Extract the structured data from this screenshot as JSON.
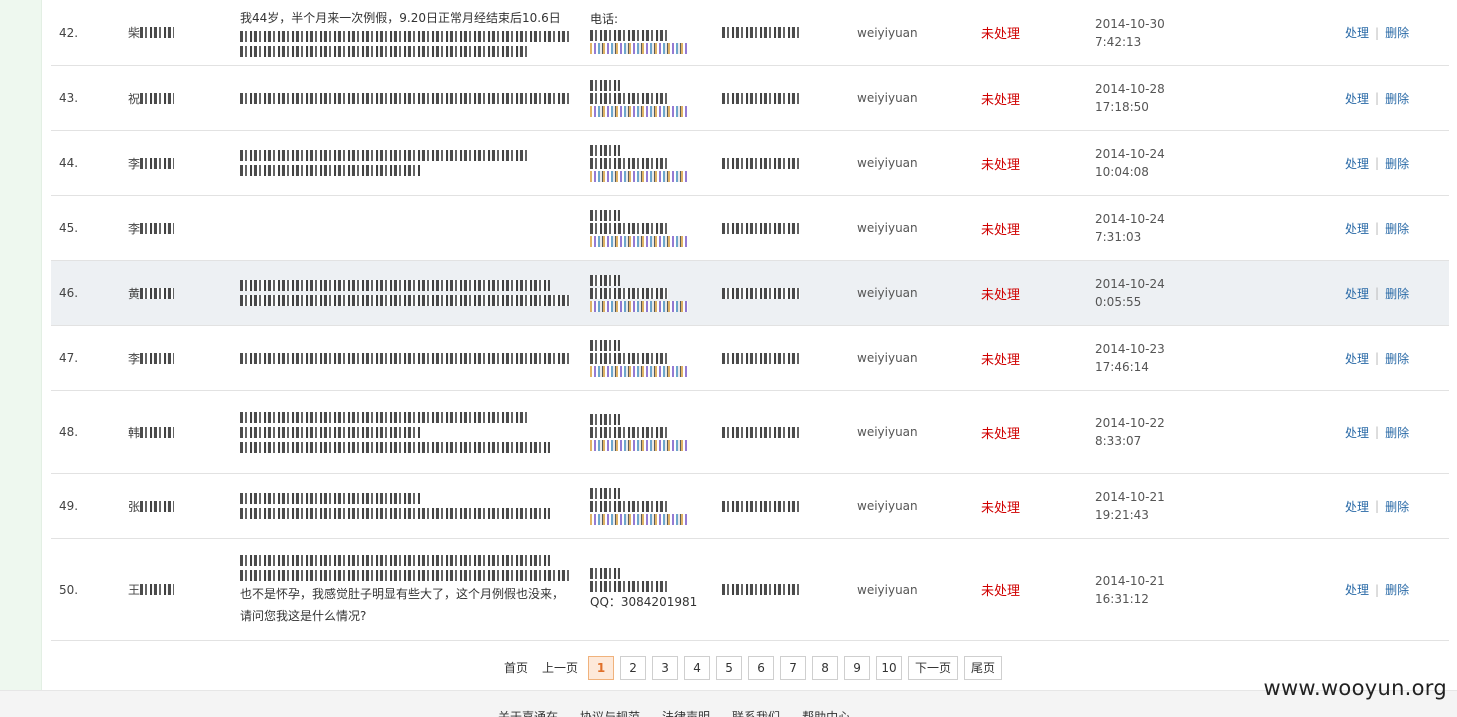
{
  "rows": [
    {
      "num": "42.",
      "name": "柴",
      "content_lines": [
        "我44岁，半个月来一次例假，9.20日正常月经结束后10.6日",
        "",
        ""
      ],
      "contact_label": "电话:",
      "user": "weiyiyuan",
      "status": "未处理",
      "date": "2014-10-30",
      "time": "7:42:13",
      "height": 66,
      "highlight": false
    },
    {
      "num": "43.",
      "name": "祝",
      "content_lines": [
        ""
      ],
      "contact_label": "",
      "user": "weiyiyuan",
      "status": "未处理",
      "date": "2014-10-28",
      "time": "17:18:50",
      "height": 65,
      "highlight": false
    },
    {
      "num": "44.",
      "name": "李",
      "content_lines": [
        "",
        ""
      ],
      "contact_label": "",
      "user": "weiyiyuan",
      "status": "未处理",
      "date": "2014-10-24",
      "time": "10:04:08",
      "height": 65,
      "highlight": false
    },
    {
      "num": "45.",
      "name": "李",
      "content_lines": [],
      "contact_label": "",
      "user": "weiyiyuan",
      "status": "未处理",
      "date": "2014-10-24",
      "time": "7:31:03",
      "height": 65,
      "highlight": false
    },
    {
      "num": "46.",
      "name": "黄",
      "content_lines": [
        "",
        ""
      ],
      "contact_label": "",
      "user": "weiyiyuan",
      "status": "未处理",
      "date": "2014-10-24",
      "time": "0:05:55",
      "height": 65,
      "highlight": true
    },
    {
      "num": "47.",
      "name": "李",
      "content_lines": [
        ""
      ],
      "contact_label": "",
      "user": "weiyiyuan",
      "status": "未处理",
      "date": "2014-10-23",
      "time": "17:46:14",
      "height": 65,
      "highlight": false
    },
    {
      "num": "48.",
      "name": "韩",
      "content_lines": [
        "",
        "",
        ""
      ],
      "contact_label": "",
      "user": "weiyiyuan",
      "status": "未处理",
      "date": "2014-10-22",
      "time": "8:33:07",
      "height": 83,
      "highlight": false
    },
    {
      "num": "49.",
      "name": "张",
      "content_lines": [
        "",
        ""
      ],
      "contact_label": "",
      "user": "weiyiyuan",
      "status": "未处理",
      "date": "2014-10-21",
      "time": "19:21:43",
      "height": 65,
      "highlight": false
    },
    {
      "num": "50.",
      "name": "王",
      "content_lines": [
        "",
        "",
        "也不是怀孕，我感觉肚子明显有些大了，这个月例假也没来，",
        "请问您我这是什么情况?"
      ],
      "contact_label": "",
      "qq": "QQ：3084201981",
      "user": "weiyiyuan",
      "status": "未处理",
      "date": "2014-10-21",
      "time": "16:31:12",
      "height": 102,
      "highlight": false
    }
  ],
  "ops": {
    "process": "处理",
    "delete": "删除"
  },
  "pager": {
    "first": "首页",
    "prev": "上一页",
    "pages": [
      "1",
      "2",
      "3",
      "4",
      "5",
      "6",
      "7",
      "8",
      "9",
      "10"
    ],
    "active": "1",
    "next": "下一页",
    "last": "尾页"
  },
  "footer": {
    "links": [
      "关于嘉通在",
      "协议与规范",
      "法律声明",
      "联系我们",
      "帮助中心"
    ]
  },
  "watermark": "www.wooyun.org"
}
